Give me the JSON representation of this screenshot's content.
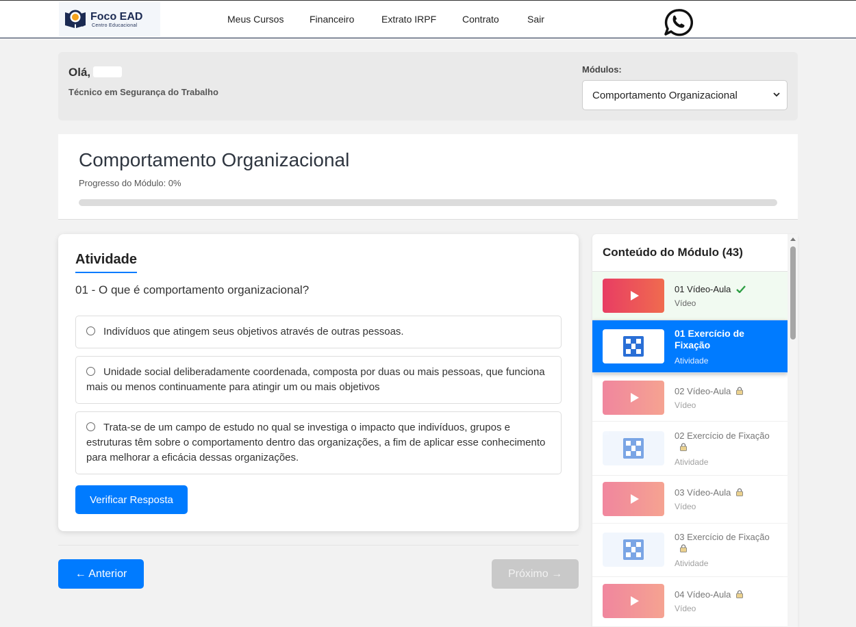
{
  "brand": {
    "title": "Foco EAD",
    "subtitle": "Centro Educacional"
  },
  "nav": [
    {
      "label": "Meus Cursos"
    },
    {
      "label": "Financeiro"
    },
    {
      "label": "Extrato IRPF"
    },
    {
      "label": "Contrato"
    },
    {
      "label": "Sair"
    }
  ],
  "greeting": {
    "hello": "Olá,",
    "course": "Técnico em Segurança do Trabalho",
    "modules_label": "Módulos:",
    "selected_module": "Comportamento Organizacional"
  },
  "module": {
    "title": "Comportamento Organizacional",
    "progress_text": "Progresso do Módulo: 0%",
    "progress_fraction": 0
  },
  "activity": {
    "heading": "Atividade",
    "question": "01 - O que é comportamento organizacional?",
    "options": [
      "Indivíduos que atingem seus objetivos através de outras pessoas.",
      "Unidade social deliberadamente coordenada, composta por duas ou mais pessoas, que funciona mais ou menos continuamente para atingir um ou mais objetivos",
      "Trata-se de um campo de estudo no qual se investiga o impacto que indivíduos, grupos e estruturas têm sobre o comportamento dentro das organizações, a fim de aplicar esse conhecimento para melhorar a eficácia dessas organizações."
    ],
    "verify_label": "Verificar Resposta"
  },
  "pager": {
    "prev_label": "← Anterior",
    "next_label": "Próximo →"
  },
  "sidebar": {
    "title": "Conteúdo do Módulo (43)",
    "items": [
      {
        "title": "01 Vídeo-Aula",
        "type": "Vídeo",
        "kind": "video",
        "state": "done"
      },
      {
        "title": "01 Exercício de Fixação",
        "type": "Atividade",
        "kind": "exercise",
        "state": "active"
      },
      {
        "title": "02 Vídeo-Aula",
        "type": "Vídeo",
        "kind": "video",
        "state": "locked"
      },
      {
        "title": "02 Exercício de Fixação",
        "type": "Atividade",
        "kind": "exercise",
        "state": "locked"
      },
      {
        "title": "03 Vídeo-Aula",
        "type": "Vídeo",
        "kind": "video",
        "state": "locked"
      },
      {
        "title": "03 Exercício de Fixação",
        "type": "Atividade",
        "kind": "exercise",
        "state": "locked"
      },
      {
        "title": "04 Vídeo-Aula",
        "type": "Vídeo",
        "kind": "video",
        "state": "locked"
      }
    ]
  },
  "colors": {
    "primary": "#007bff",
    "navy": "#1b2a52",
    "done_check": "#2e9e44",
    "lock": "#e0b64a"
  }
}
